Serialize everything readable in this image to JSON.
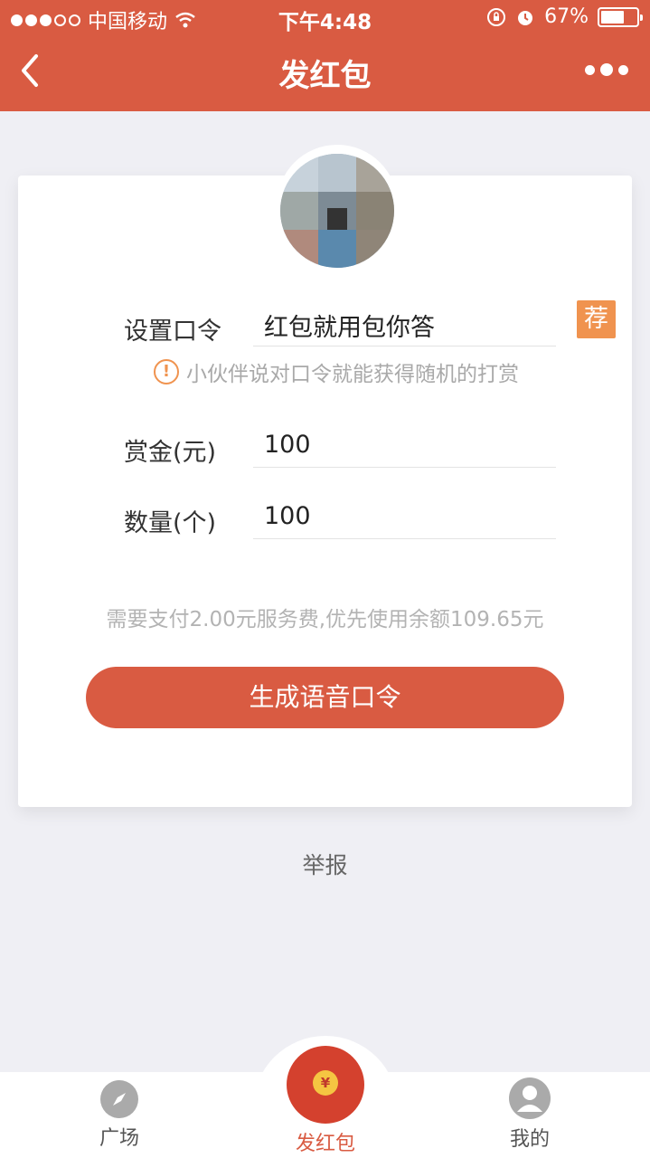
{
  "status_bar": {
    "carrier": "中国移动",
    "time": "下午4:48",
    "battery": "67%",
    "battery_level": 0.67
  },
  "nav": {
    "title": "发红包"
  },
  "form": {
    "password_label": "设置口令",
    "password_value": "红包就用包你答",
    "recommend_tag": "荐",
    "hint_text": "小伙伴说对口令就能获得随机的打赏",
    "reward_label": "赏金(元)",
    "reward_value": "100",
    "quantity_label": "数量(个)",
    "quantity_value": "100",
    "fee_note": "需要支付2.00元服务费,优先使用余额109.65元",
    "submit_label": "生成语音口令"
  },
  "report_label": "举报",
  "tabbar": {
    "items": [
      {
        "label": "广场"
      },
      {
        "label": "发红包"
      },
      {
        "label": "我的"
      }
    ],
    "coin_symbol": "¥"
  },
  "colors": {
    "accent": "#d95b42",
    "tag": "#f0934f"
  }
}
